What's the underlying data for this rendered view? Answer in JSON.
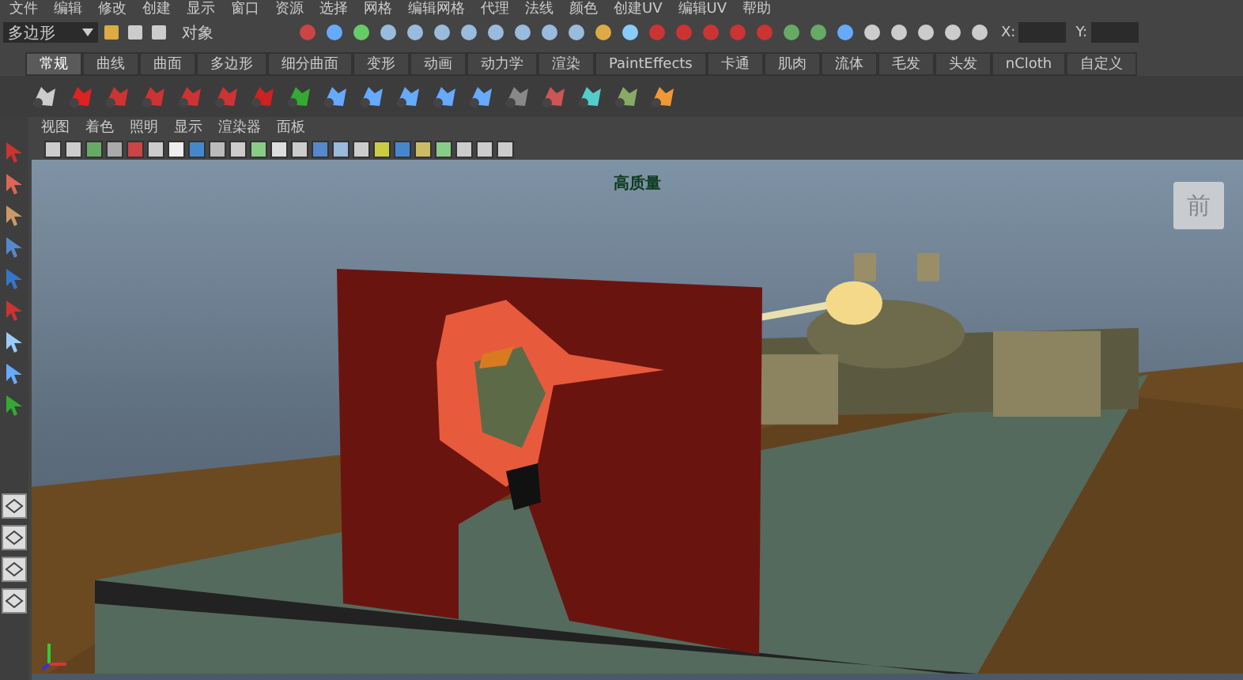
{
  "menu_bar": {
    "items": [
      "文件",
      "编辑",
      "修改",
      "创建",
      "显示",
      "窗口",
      "资源",
      "选择",
      "网格",
      "编辑网格",
      "代理",
      "法线",
      "颜色",
      "创建UV",
      "编辑UV",
      "帮助"
    ]
  },
  "status_line": {
    "mode_menu": "多边形",
    "object_field": "对象",
    "x_label": "X:",
    "y_label": "Y:"
  },
  "shelf_tabs": [
    {
      "label": "常规",
      "selected": true
    },
    {
      "label": "曲线",
      "selected": false
    },
    {
      "label": "曲面",
      "selected": false
    },
    {
      "label": "多边形",
      "selected": false
    },
    {
      "label": "细分曲面",
      "selected": false
    },
    {
      "label": "变形",
      "selected": false
    },
    {
      "label": "动画",
      "selected": false
    },
    {
      "label": "动力学",
      "selected": false
    },
    {
      "label": "渲染",
      "selected": false
    },
    {
      "label": "PaintEffects",
      "selected": false
    },
    {
      "label": "卡通",
      "selected": false
    },
    {
      "label": "肌肉",
      "selected": false
    },
    {
      "label": "流体",
      "selected": false
    },
    {
      "label": "毛发",
      "selected": false
    },
    {
      "label": "头发",
      "selected": false
    },
    {
      "label": "nCloth",
      "selected": false
    },
    {
      "label": "自定义",
      "selected": false
    }
  ],
  "panel_menu": [
    "视图",
    "着色",
    "照明",
    "显示",
    "渲染器",
    "面板"
  ],
  "viewport": {
    "hud_title": "高质量",
    "view_cube_label": "前"
  }
}
